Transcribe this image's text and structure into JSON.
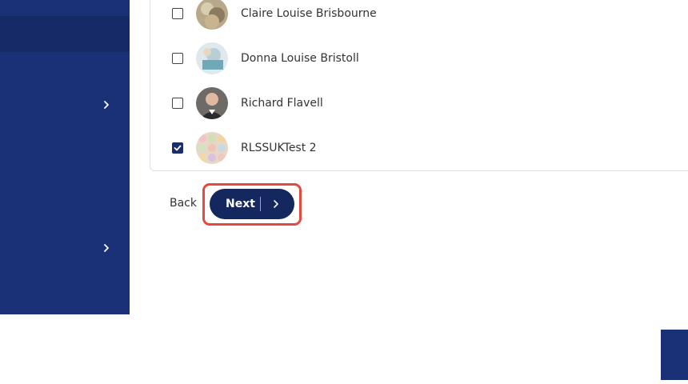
{
  "sidebar": {
    "items": [
      {
        "icon": "chevron-right-icon"
      },
      {
        "icon": "chevron-right-icon"
      }
    ]
  },
  "members": [
    {
      "name": "Claire Louise Brisbourne",
      "checked": false
    },
    {
      "name": "Donna Louise Bristoll",
      "checked": false
    },
    {
      "name": "Richard Flavell",
      "checked": false
    },
    {
      "name": "RLSSUKTest 2",
      "checked": true
    }
  ],
  "actions": {
    "back_label": "Back",
    "next_label": "Next",
    "next_icon": "chevron-right-icon"
  },
  "colors": {
    "sidebar": "#1a3178",
    "button": "#14275e",
    "highlight": "#e5483e"
  }
}
